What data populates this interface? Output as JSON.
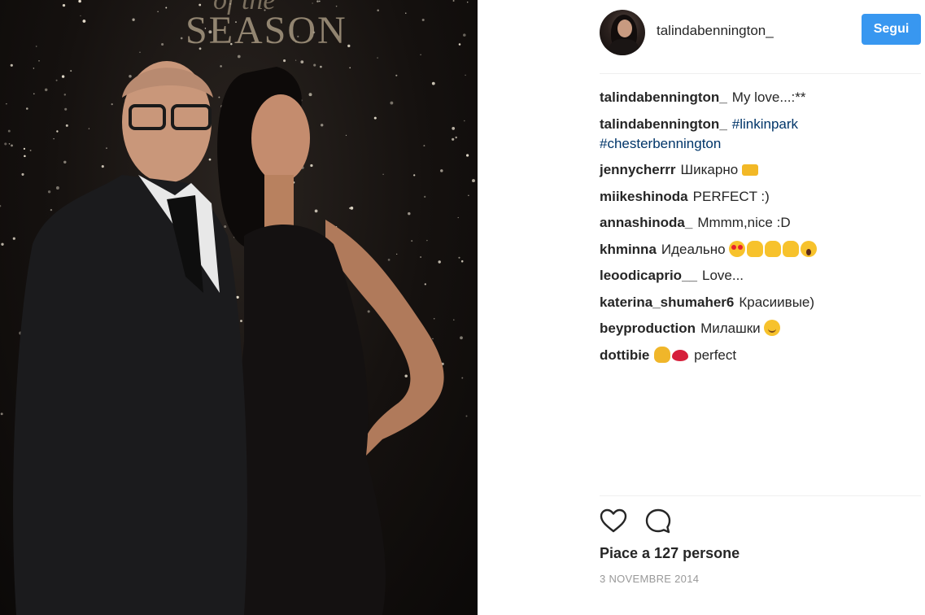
{
  "photo": {
    "banner_top": "of the",
    "banner_main": "SEASON"
  },
  "header": {
    "username": "talindabennington_",
    "follow_label": "Segui"
  },
  "comments": [
    {
      "user": "talindabennington_",
      "text": "My love...:**",
      "emojis": []
    },
    {
      "user": "talindabennington_",
      "text": "",
      "tags": [
        "#linkinpark",
        "#chesterbennington"
      ],
      "emojis": []
    },
    {
      "user": "jennycherrr",
      "text": "Шикарно",
      "emojis": [
        "crown"
      ]
    },
    {
      "user": "miikeshinoda",
      "text": "PERFECT :)",
      "emojis": []
    },
    {
      "user": "annashinoda_",
      "text": "Mmmm,nice :D",
      "emojis": []
    },
    {
      "user": "khminna",
      "text": "Идеально",
      "emojis": [
        "heart-eyes",
        "thumbs-up",
        "thumbs-up",
        "thumbs-up",
        "scream"
      ]
    },
    {
      "user": "leoodicaprio__",
      "text": "Love...",
      "emojis": []
    },
    {
      "user": "katerina_shumaher6",
      "text": "Красиивые)",
      "emojis": []
    },
    {
      "user": "beyproduction",
      "text": "Милашки",
      "emojis": [
        "smile"
      ]
    },
    {
      "user": "dottibie",
      "text": "perfect",
      "emojis": [
        "clap",
        "lips"
      ]
    }
  ],
  "actions": {
    "like_icon": "heart-icon",
    "comment_icon": "comment-icon"
  },
  "likes_text": "Piace a 127 persone",
  "date_text": "3 NOVEMBRE 2014",
  "colors": {
    "follow_button": "#3897f0",
    "hashtag": "#003569",
    "text": "#262626",
    "muted": "#999999"
  }
}
